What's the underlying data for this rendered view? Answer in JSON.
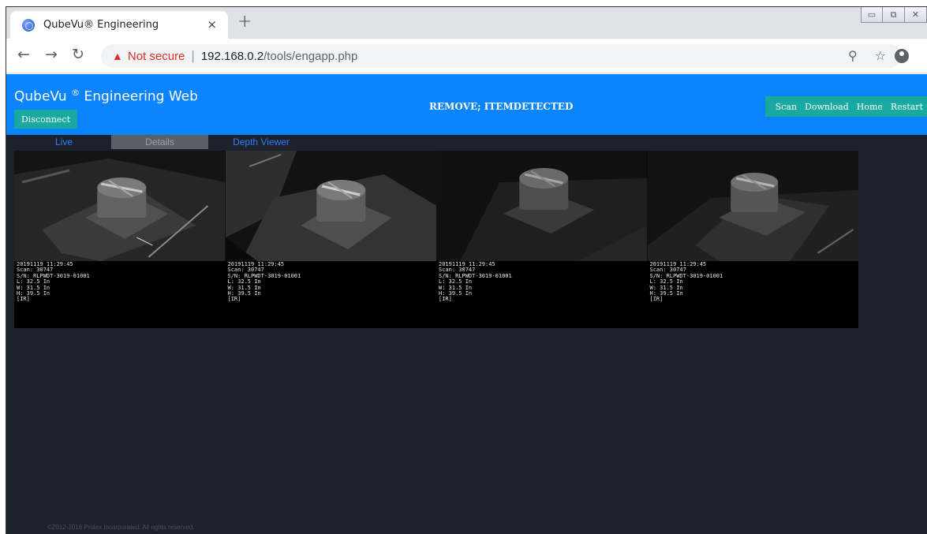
{
  "browser": {
    "tab_title": "QubeVu® Engineering",
    "tab_close": "×",
    "new_tab": "+",
    "not_secure": "Not secure",
    "url_host": "192.168.0.2",
    "url_path": "/tools/engapp.php"
  },
  "app": {
    "brand_name": "QubeVu",
    "brand_mark": "®",
    "brand_suffix": " Engineering Web",
    "disconnect_label": "Disconnect",
    "status": "REMOVE; ITEMDETECTED",
    "header_buttons": [
      "Scan",
      "Download",
      "Home",
      "Restart"
    ]
  },
  "tabs": {
    "live": "Live",
    "details": "Details",
    "depth_viewer": "Depth Viewer"
  },
  "scans": [
    {
      "datetime": "20191119 11:29:45",
      "scan": "Scan: 30747",
      "serial": "S/N: RLPWDT-3019-01001",
      "length": "L: 32.5 In",
      "width": "W: 31.5 In",
      "height": "H: 39.5 In",
      "mode": "[IR]"
    },
    {
      "datetime": "20191119 11:29:45",
      "scan": "Scan: 30747",
      "serial": "S/N: RLPWDT-3019-01001",
      "length": "L: 32.5 In",
      "width": "W: 31.5 In",
      "height": "H: 39.5 In",
      "mode": "[IR]"
    },
    {
      "datetime": "20191119 11:29:45",
      "scan": "Scan: 30747",
      "serial": "S/N: RLPWDT-3019-01001",
      "length": "L: 32.5 In",
      "width": "W: 31.5 In",
      "height": "H: 39.5 In",
      "mode": "[IR]"
    },
    {
      "datetime": "20191119 11:29:45",
      "scan": "Scan: 30747",
      "serial": "S/N: RLPWDT-3019-01001",
      "length": "L: 32.5 In",
      "width": "W: 31.5 In",
      "height": "H: 39.5 In",
      "mode": "[IR]"
    }
  ],
  "footer": "©2012-2018 Prolex Incorporated. All rights reserved.",
  "colors": {
    "header_blue": "#0c84ff",
    "teal_button": "#1aa9a0",
    "page_bg": "#1b212d",
    "tab_link": "#2f7dff",
    "warning_red": "#d93025"
  },
  "icons": [
    "globe-favicon-icon",
    "back-arrow-icon",
    "forward-arrow-icon",
    "reload-icon",
    "warning-icon",
    "zoom-icon",
    "star-icon",
    "profile-icon",
    "menu-dots-icon",
    "minimize-icon",
    "maximize-icon",
    "close-window-icon"
  ]
}
